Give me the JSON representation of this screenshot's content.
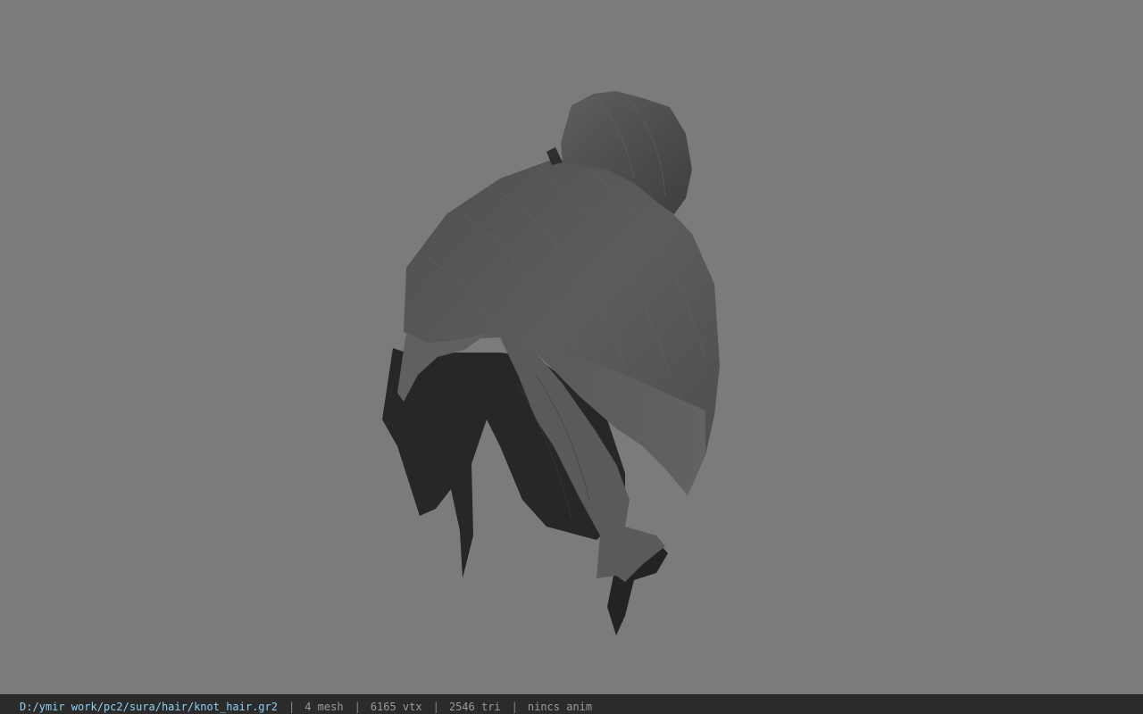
{
  "viewport": {
    "background_color": "#7b7b7b",
    "model_name": "knot_hair",
    "model_colors": {
      "dark": "#2a2a2a",
      "mid": "#4d4d4d",
      "light": "#5a5a5a",
      "highlight": "#6a6a6a"
    }
  },
  "statusbar": {
    "file_path": "D:/ymir work/pc2/sura/hair/knot_hair.gr2",
    "separator": "|",
    "mesh": "4 mesh",
    "vertices": "6165 vtx",
    "triangles": "2546 tri",
    "anim": "nincs anim",
    "path_color": "#8fd0f0",
    "text_color": "#9a9a9a"
  }
}
